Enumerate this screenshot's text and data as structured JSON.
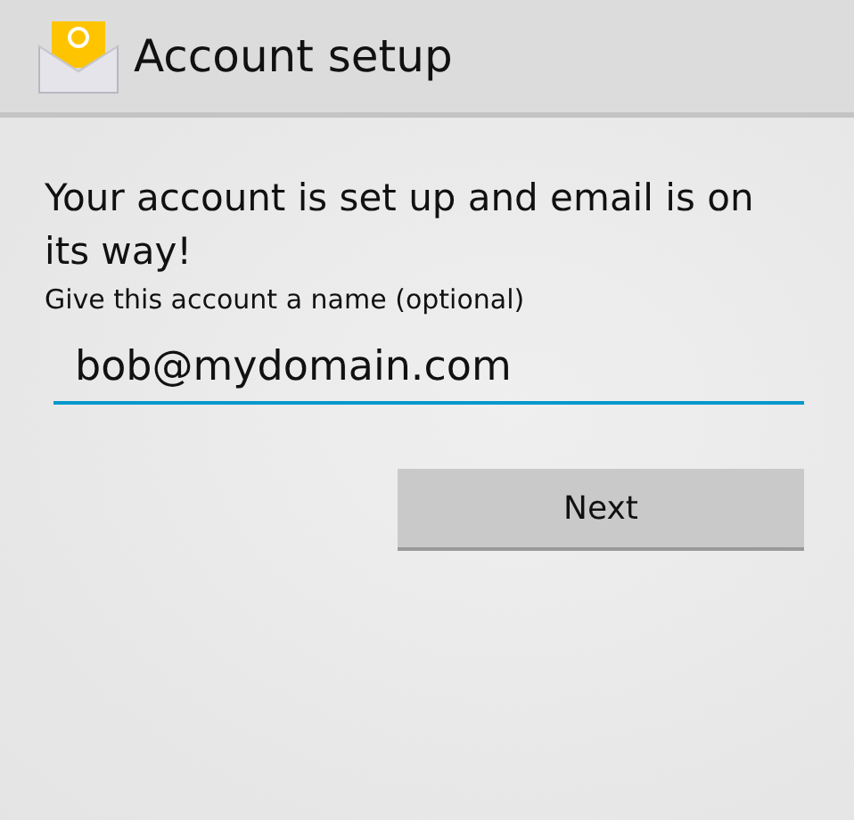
{
  "action_bar": {
    "title": "Account setup"
  },
  "heading": "Your account is set up and email is on its way!",
  "name_field": {
    "label": "Give this account a name (optional)",
    "value": "bob@mydomain.com"
  },
  "buttons": [
    "Next"
  ]
}
